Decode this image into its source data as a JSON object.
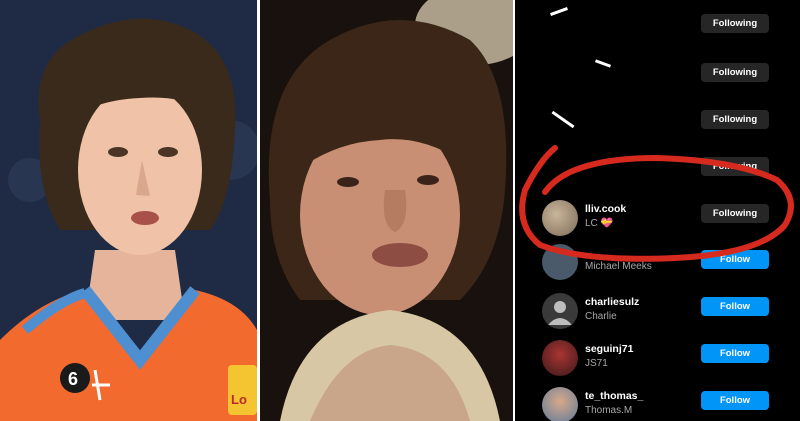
{
  "photos": {
    "left": {
      "jersey_number": "6",
      "badge_text": "Lo"
    },
    "middle": {}
  },
  "following_list": {
    "rows": [
      {
        "username": "",
        "display_name": "",
        "button": "Following",
        "state": "following"
      },
      {
        "username": "",
        "display_name": "",
        "button": "Following",
        "state": "following"
      },
      {
        "username": "",
        "display_name": "",
        "button": "Following",
        "state": "following"
      },
      {
        "username": "",
        "display_name": "",
        "button": "Following",
        "state": "following"
      },
      {
        "username": "lliv.cook",
        "display_name": "LC 💝",
        "button": "Following",
        "state": "following"
      },
      {
        "username": "",
        "display_name": "Michael Meeks",
        "button": "Follow",
        "state": "follow"
      },
      {
        "username": "charliesulz",
        "display_name": "Charlie",
        "button": "Follow",
        "state": "follow"
      },
      {
        "username": "seguinj71",
        "display_name": "JS71",
        "button": "Follow",
        "state": "follow"
      },
      {
        "username": "te_thomas_",
        "display_name": "Thomas.M",
        "button": "Follow",
        "state": "follow"
      }
    ]
  },
  "colors": {
    "follow_blue": "#0095f6",
    "following_gray": "#262626",
    "annotation_red": "#d62a1e",
    "jersey_orange": "#f26a2e",
    "jersey_blue": "#4e8fd1"
  }
}
